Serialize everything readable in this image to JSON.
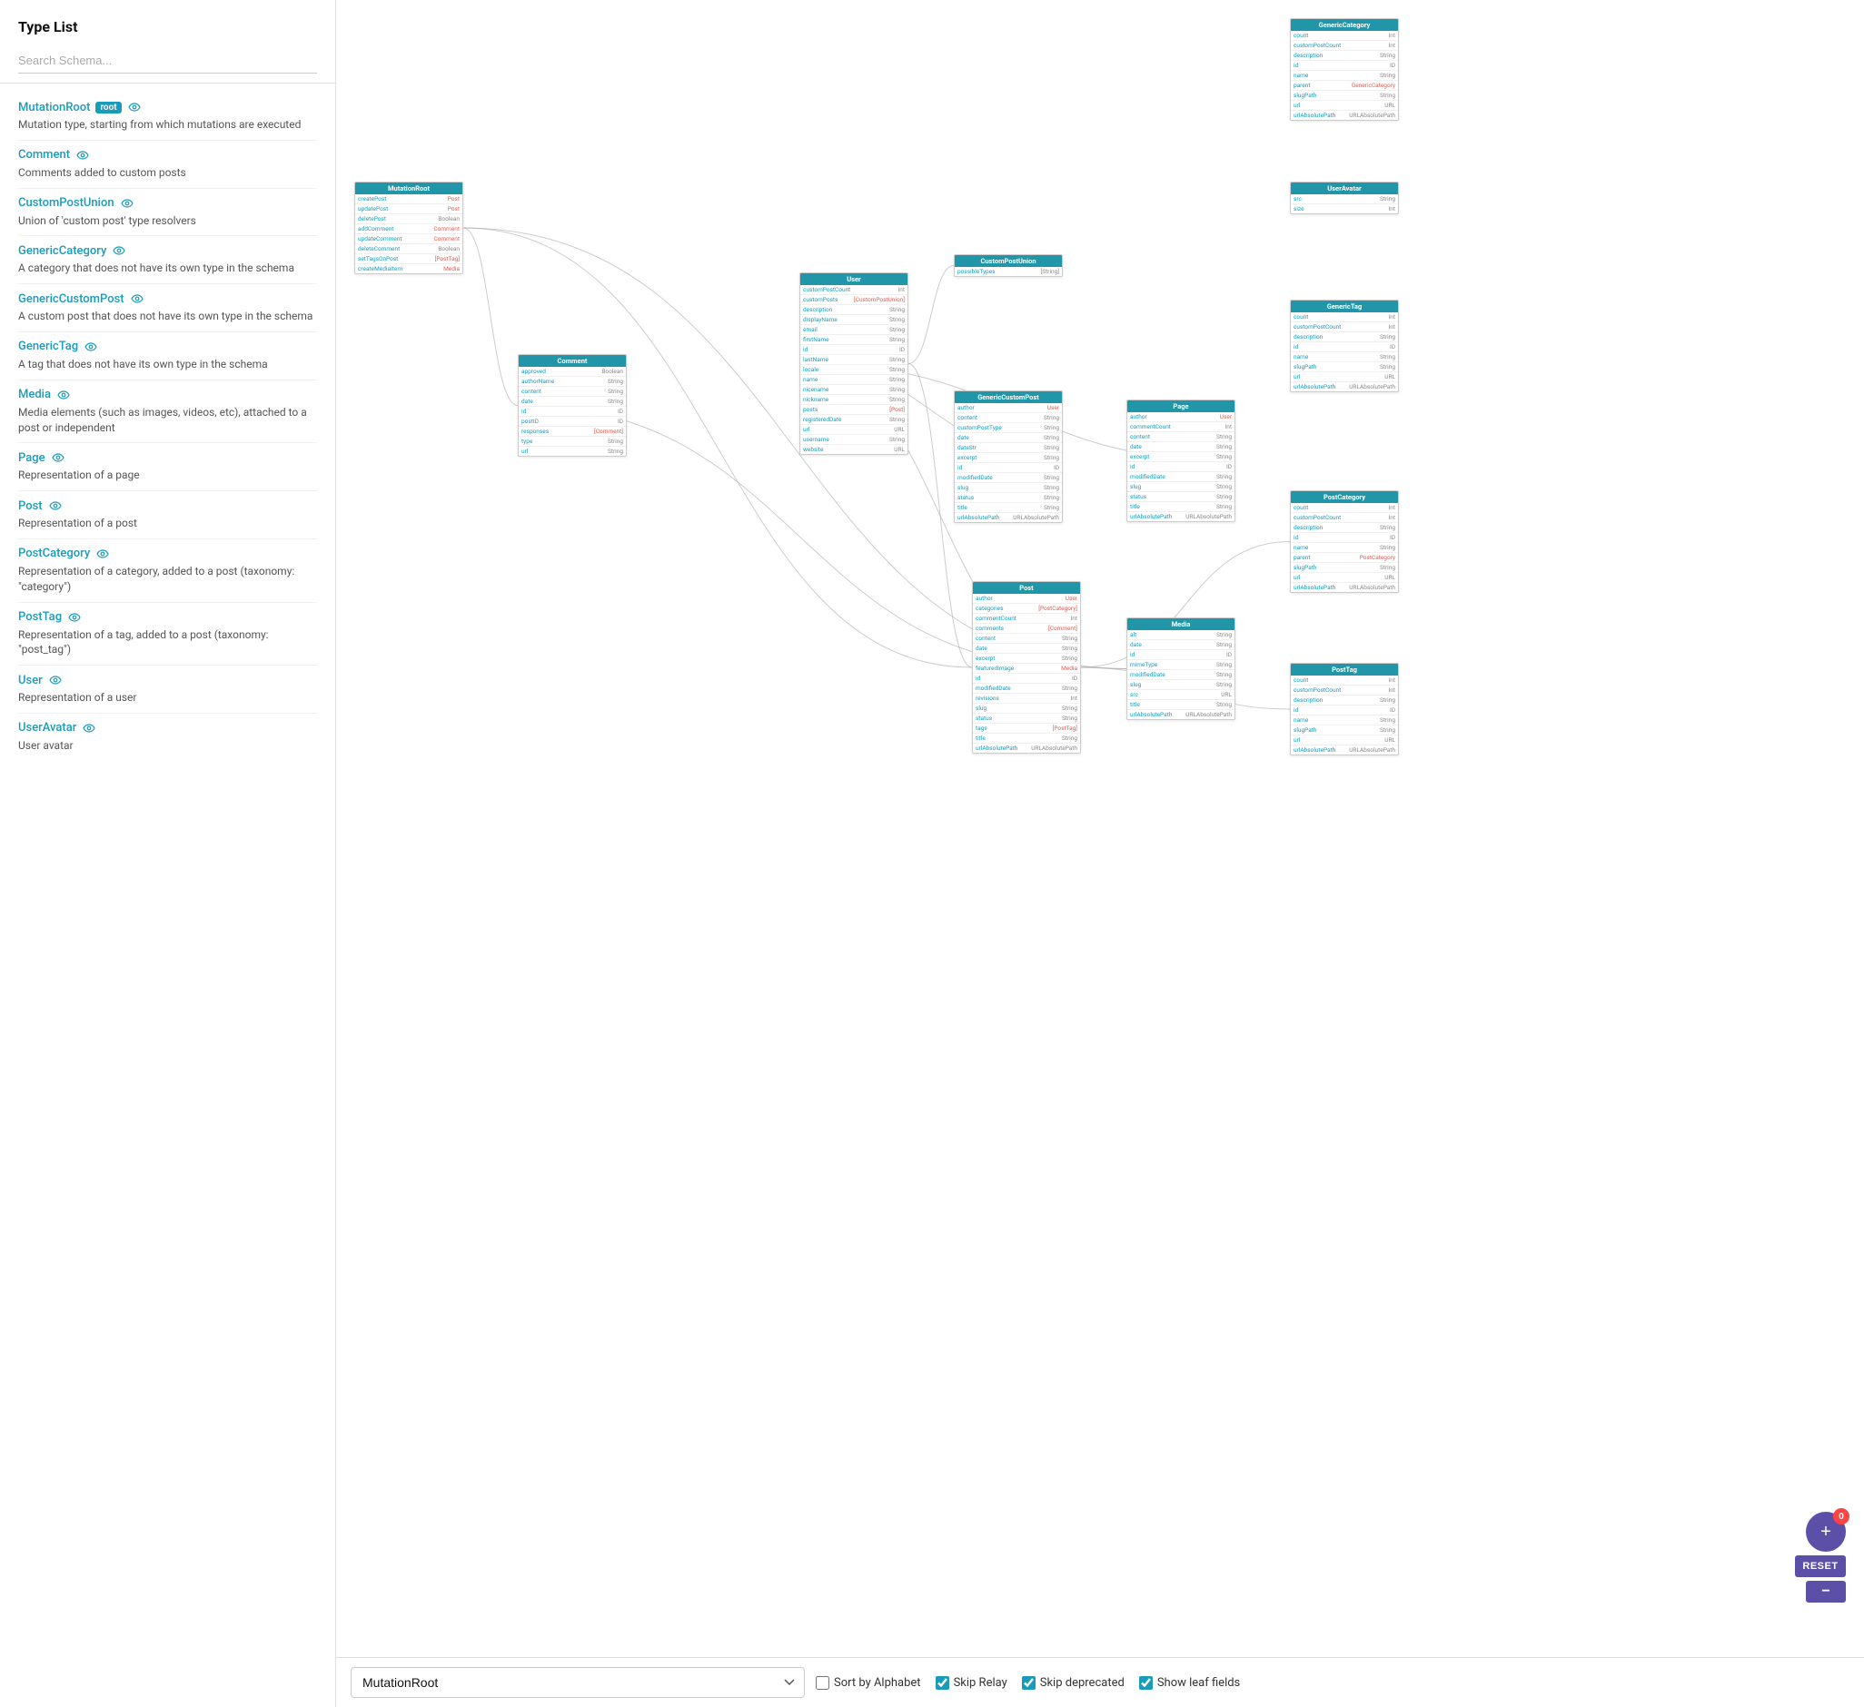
{
  "sidebar": {
    "title": "Type List",
    "search_placeholder": "Search Schema...",
    "items": [
      {
        "id": "MutationRoot",
        "name": "MutationRoot",
        "badge": "root",
        "desc": "Mutation type, starting from which mutations are executed",
        "has_eye": true
      },
      {
        "id": "Comment",
        "name": "Comment",
        "badge": null,
        "desc": "Comments added to custom posts",
        "has_eye": true
      },
      {
        "id": "CustomPostUnion",
        "name": "CustomPostUnion",
        "badge": null,
        "desc": "Union of 'custom post' type resolvers",
        "has_eye": true
      },
      {
        "id": "GenericCategory",
        "name": "GenericCategory",
        "badge": null,
        "desc": "A category that does not have its own type in the schema",
        "has_eye": true
      },
      {
        "id": "GenericCustomPost",
        "name": "GenericCustomPost",
        "badge": null,
        "desc": "A custom post that does not have its own type in the schema",
        "has_eye": true
      },
      {
        "id": "GenericTag",
        "name": "GenericTag",
        "badge": null,
        "desc": "A tag that does not have its own type in the schema",
        "has_eye": true
      },
      {
        "id": "Media",
        "name": "Media",
        "badge": null,
        "desc": "Media elements (such as images, videos, etc), attached to a post or independent",
        "has_eye": true
      },
      {
        "id": "Page",
        "name": "Page",
        "badge": null,
        "desc": "Representation of a page",
        "has_eye": true
      },
      {
        "id": "Post",
        "name": "Post",
        "badge": null,
        "desc": "Representation of a post",
        "has_eye": true
      },
      {
        "id": "PostCategory",
        "name": "PostCategory",
        "badge": null,
        "desc": "Representation of a category, added to a post (taxonomy: \"category\")",
        "has_eye": true
      },
      {
        "id": "PostTag",
        "name": "PostTag",
        "badge": null,
        "desc": "Representation of a tag, added to a post (taxonomy: \"post_tag\")",
        "has_eye": true
      },
      {
        "id": "User",
        "name": "User",
        "badge": null,
        "desc": "Representation of a user",
        "has_eye": true
      },
      {
        "id": "UserAvatar",
        "name": "UserAvatar",
        "badge": null,
        "desc": "User avatar",
        "has_eye": true
      }
    ]
  },
  "toolbar": {
    "selected_type": "MutationRoot",
    "type_options": [
      "MutationRoot",
      "Comment",
      "CustomPostUnion",
      "GenericCategory",
      "GenericCustomPost",
      "GenericTag",
      "Media",
      "Page",
      "Post",
      "PostCategory",
      "PostTag",
      "User",
      "UserAvatar"
    ],
    "sort_by_alphabet": false,
    "skip_relay": true,
    "skip_deprecated": true,
    "show_leaf_fields": true,
    "sort_by_alphabet_label": "Sort by Alphabet",
    "skip_relay_label": "Skip Relay",
    "skip_deprecated_label": "Skip deprecated",
    "show_leaf_fields_label": "Show leaf fields"
  },
  "fab": {
    "add_label": "+",
    "badge_count": "0",
    "reset_label": "RESET",
    "minus_label": "−"
  },
  "colors": {
    "accent": "#1a9bba",
    "node_header": "#2196a8",
    "fab_bg": "#5c4fa8"
  }
}
